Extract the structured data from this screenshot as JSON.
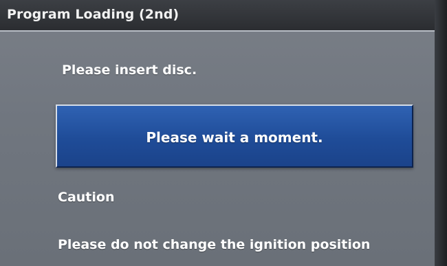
{
  "title": "Program Loading (2nd)",
  "messages": {
    "insert_disc": "Please insert disc.",
    "wait": "Please wait a moment.",
    "caution": "Caution",
    "ignition_warning": "Please do not change the ignition position"
  },
  "colors": {
    "title_bar": "#2f3236",
    "screen_background": "#747a82",
    "panel": "#2457a7",
    "text": "#ffffff"
  }
}
